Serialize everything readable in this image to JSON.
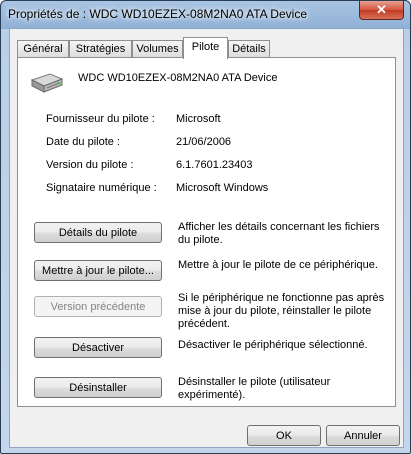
{
  "window": {
    "title": "Propriétés de : WDC WD10EZEX-08M2NA0 ATA Device",
    "close_glyph": "✕"
  },
  "tabs": [
    {
      "label": "Général"
    },
    {
      "label": "Stratégies"
    },
    {
      "label": "Volumes"
    },
    {
      "label": "Pilote",
      "active": true
    },
    {
      "label": "Détails"
    }
  ],
  "device": {
    "name": "WDC WD10EZEX-08M2NA0 ATA Device",
    "icon": "hard-drive-icon"
  },
  "info": [
    {
      "label": "Fournisseur du pilote :",
      "value": "Microsoft"
    },
    {
      "label": "Date du pilote :",
      "value": "21/06/2006"
    },
    {
      "label": "Version du pilote :",
      "value": "6.1.7601.23403"
    },
    {
      "label": "Signataire numérique :",
      "value": "Microsoft Windows"
    }
  ],
  "actions": [
    {
      "button": "Détails du pilote",
      "desc": "Afficher les détails concernant les fichiers du pilote.",
      "enabled": true
    },
    {
      "button": "Mettre à jour le pilote...",
      "desc": "Mettre à jour le pilote de ce périphérique.",
      "enabled": true
    },
    {
      "button": "Version précédente",
      "desc": "Si le périphérique ne fonctionne pas après mise à jour du pilote, réinstaller le pilote précédent.",
      "enabled": false
    },
    {
      "button": "Désactiver",
      "desc": "Désactiver le périphérique sélectionné.",
      "enabled": true
    },
    {
      "button": "Désinstaller",
      "desc": "Désinstaller le pilote (utilisateur expérimenté).",
      "enabled": true
    }
  ],
  "footer": {
    "ok": "OK",
    "cancel": "Annuler"
  }
}
